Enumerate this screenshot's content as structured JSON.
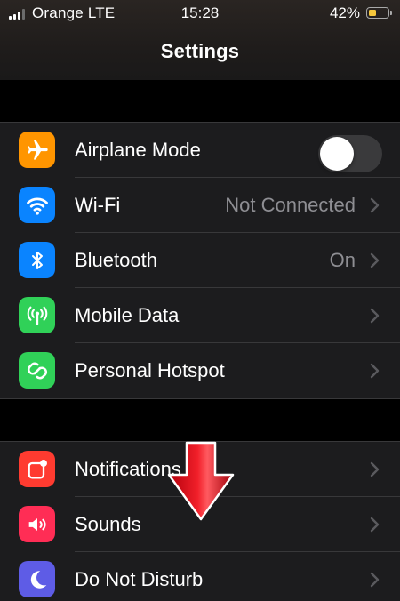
{
  "status_bar": {
    "carrier": "Orange LTE",
    "time": "15:28",
    "battery_percent": "42%",
    "battery_level": 0.42,
    "signal_bars": 4,
    "signal_active": 3
  },
  "nav": {
    "title": "Settings"
  },
  "groups": [
    {
      "items": [
        {
          "label": "Airplane Mode",
          "icon": "airplane-icon",
          "icon_color": "#ff9500",
          "control": "toggle",
          "toggle_on": false
        },
        {
          "label": "Wi-Fi",
          "icon": "wifi-icon",
          "icon_color": "#0a84ff",
          "value": "Not Connected",
          "control": "chevron"
        },
        {
          "label": "Bluetooth",
          "icon": "bluetooth-icon",
          "icon_color": "#0a84ff",
          "value": "On",
          "control": "chevron"
        },
        {
          "label": "Mobile Data",
          "icon": "antenna-icon",
          "icon_color": "#30d158",
          "control": "chevron"
        },
        {
          "label": "Personal Hotspot",
          "icon": "link-icon",
          "icon_color": "#30d158",
          "control": "chevron"
        }
      ]
    },
    {
      "items": [
        {
          "label": "Notifications",
          "icon": "notification-icon",
          "icon_color": "#ff3b30",
          "control": "chevron"
        },
        {
          "label": "Sounds",
          "icon": "speaker-icon",
          "icon_color": "#ff2d55",
          "control": "chevron"
        },
        {
          "label": "Do Not Disturb",
          "icon": "moon-icon",
          "icon_color": "#5e5ce6",
          "control": "chevron"
        }
      ]
    }
  ],
  "overlay": {
    "arrow_color": "#e8121c",
    "arrow_icon": "red-down-arrow-icon"
  }
}
